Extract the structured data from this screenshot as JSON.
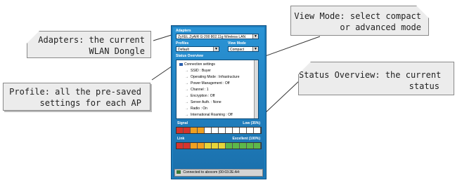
{
  "callouts": {
    "adapters": {
      "line1": "Adapters: the current",
      "line2": "WLAN Dongle"
    },
    "view_mode": {
      "line1": "View Mode: select compact",
      "line2": "or advanced mode"
    },
    "profile": {
      "line1": "Profile: all the pre-saved",
      "line2": "settings for each AP"
    },
    "status_overview": {
      "line1": "Status Overview: the current",
      "line2": "status"
    }
  },
  "window": {
    "adapters_label": "Adapters",
    "adapter_value": "ZyXEL ZyAIR G-200 802.11g Wireless LAN",
    "profiles_label": "Profiles",
    "profile_value": "Default",
    "view_mode_label": "View Mode",
    "view_mode_value": "Compact",
    "status_overview_label": "Status Overview",
    "tree": {
      "root": "Connection settings",
      "items": [
        "SSID : Buyer",
        "Operating Mode : Infrastructure",
        "Power Management : Off",
        "Channel : 1",
        "Encryption : Off",
        "Server Auth. : None",
        "Radio : On",
        "International Roaming : Off"
      ]
    },
    "signal_label": "Signal",
    "signal_value": "Low (35%)",
    "link_label": "Link",
    "link_value": "Excellent (100%)",
    "status_bar_text": "Connected to abocom (00:03:2E:A4:"
  },
  "colors": {
    "window_blue": "#1d7ebd",
    "meter_red": "#d6342d",
    "meter_orange": "#f0a020",
    "meter_yellow": "#e6d43a",
    "meter_green": "#5db84a"
  }
}
